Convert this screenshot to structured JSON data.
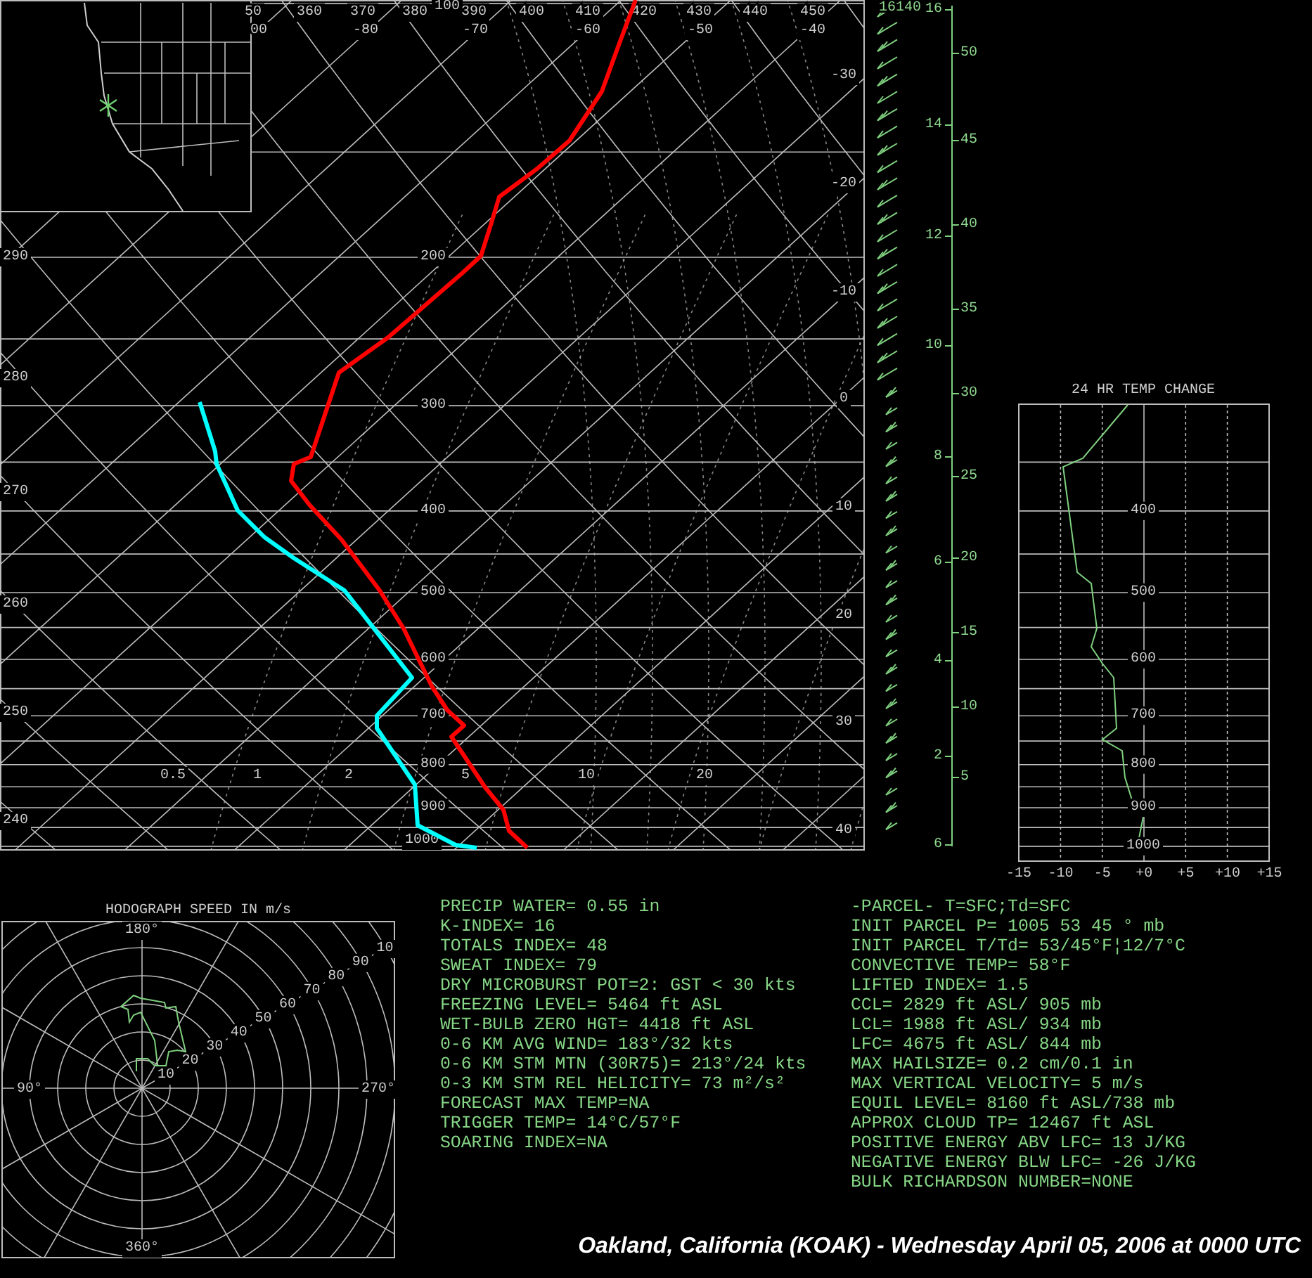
{
  "skew_t": {
    "top_theta_labels": [
      "50",
      "360",
      "370",
      "380",
      "390",
      "400",
      "410",
      "420",
      "430",
      "440",
      "450"
    ],
    "top_temp_labels": [
      "100",
      "00",
      "-80",
      "-70",
      "-60",
      "-50",
      "-40"
    ],
    "theta_labels": [
      "290",
      "280",
      "270",
      "260",
      "250",
      "240"
    ],
    "pressure_labels": [
      "200",
      "300",
      "400",
      "500",
      "600",
      "700",
      "800",
      "900",
      "1000"
    ],
    "mixing_ratio_labels": [
      "0.5",
      "1",
      "2",
      "5",
      "10",
      "20"
    ],
    "temp_labels": [
      "-30",
      "-20",
      "-10",
      "0",
      "10",
      "20",
      "30",
      "40"
    ]
  },
  "height_axis": {
    "top_label": "16140",
    "km_labels": [
      "16",
      "14",
      "12",
      "10",
      "8",
      "6",
      "4",
      "2",
      "6"
    ],
    "kft_labels": [
      "50",
      "45",
      "40",
      "35",
      "30",
      "25",
      "20",
      "15",
      "10",
      "5"
    ]
  },
  "temp_change_panel": {
    "title": "24 HR TEMP CHANGE",
    "pressure_labels": [
      "400",
      "500",
      "600",
      "700",
      "800",
      "900",
      "1000"
    ],
    "x_ticks": [
      "-15",
      "-10",
      "-5",
      "+0",
      "+5",
      "+10",
      "+15"
    ]
  },
  "hodograph": {
    "title": "HODOGRAPH SPEED IN m/s",
    "direction_labels": [
      "180°",
      "90°",
      "270°",
      "360°"
    ],
    "speed_labels": [
      "10",
      "20",
      "30",
      "40",
      "50",
      "60",
      "70",
      "80",
      "90",
      "10"
    ]
  },
  "indices_left": [
    "PRECIP WATER= 0.55 in",
    "K-INDEX= 16",
    "TOTALS INDEX= 48",
    "SWEAT INDEX= 79",
    "DRY MICROBURST POT=2: GST < 30 kts",
    "FREEZING LEVEL= 5464 ft ASL",
    "WET-BULB ZERO HGT= 4418 ft ASL",
    "0-6 KM AVG WIND= 183°/32 kts",
    "0-6 KM STM MTN (30R75)= 213°/24 kts",
    "0-3 KM STM REL HELICITY= 73 m²/s²",
    "FORECAST MAX TEMP=NA",
    "TRIGGER TEMP= 14°C/57°F",
    "SOARING INDEX=NA"
  ],
  "indices_right": [
    "-PARCEL- T=SFC;Td=SFC",
    "INIT PARCEL P= 1005 53 45 ° mb",
    "INIT PARCEL T/Td= 53/45°F¦12/7°C",
    "CONVECTIVE TEMP= 58°F",
    "LIFTED INDEX= 1.5",
    "CCL= 2829 ft ASL/ 905 mb",
    "LCL= 1988 ft ASL/ 934 mb",
    "LFC= 4675 ft ASL/ 844 mb",
    "MAX HAILSIZE= 0.2 cm/0.1 in",
    "MAX VERTICAL VELOCITY= 5 m/s",
    "EQUIL LEVEL= 8160 ft ASL/738 mb",
    "APPROX CLOUD TP= 12467 ft ASL",
    "POSITIVE ENERGY ABV LFC= 13 J/KG",
    "NEGATIVE ENERGY BLW LFC= -26 J/KG",
    "BULK RICHARDSON NUMBER=NONE"
  ],
  "footer_title": "Oakland, California (KOAK) - Wednesday April 05, 2006 at 0000 UTC"
}
